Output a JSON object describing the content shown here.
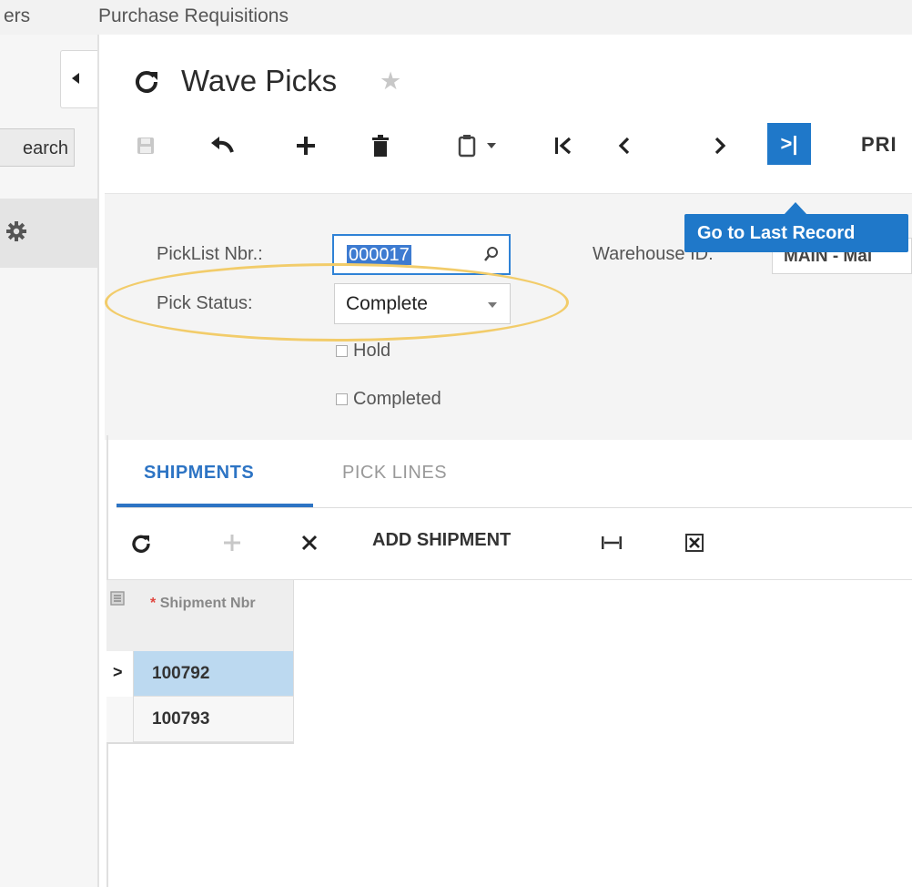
{
  "breadcrumbs": [
    "ers",
    "Purchase Requisitions"
  ],
  "sidebar": {
    "search_label": "earch"
  },
  "page": {
    "title": "Wave Picks"
  },
  "toolbar": {
    "print_label": "PRI",
    "last_record_glyph": ">|",
    "tooltip": "Go to Last Record"
  },
  "form": {
    "picklist_label": "PickList Nbr.:",
    "picklist_value": "000017",
    "warehouse_label": "Warehouse ID:",
    "warehouse_value": "MAIN - Mai",
    "status_label": "Pick Status:",
    "status_value": "Complete",
    "hold_label": "Hold",
    "completed_label": "Completed"
  },
  "tabs": [
    {
      "label": "SHIPMENTS",
      "active": true
    },
    {
      "label": "PICK LINES",
      "active": false
    }
  ],
  "grid_toolbar": {
    "add_shipment_label": "ADD SHIPMENT"
  },
  "grid": {
    "required_marker": "*",
    "column_header": "Shipment Nbr",
    "rows": [
      {
        "shipment_nbr": "100792",
        "selected": true,
        "indicator": ">"
      },
      {
        "shipment_nbr": "100793",
        "selected": false,
        "indicator": ""
      }
    ]
  },
  "colors": {
    "accent": "#1f78c9",
    "highlight": "#f2cc6a",
    "selected_row": "#bcd9f0"
  }
}
